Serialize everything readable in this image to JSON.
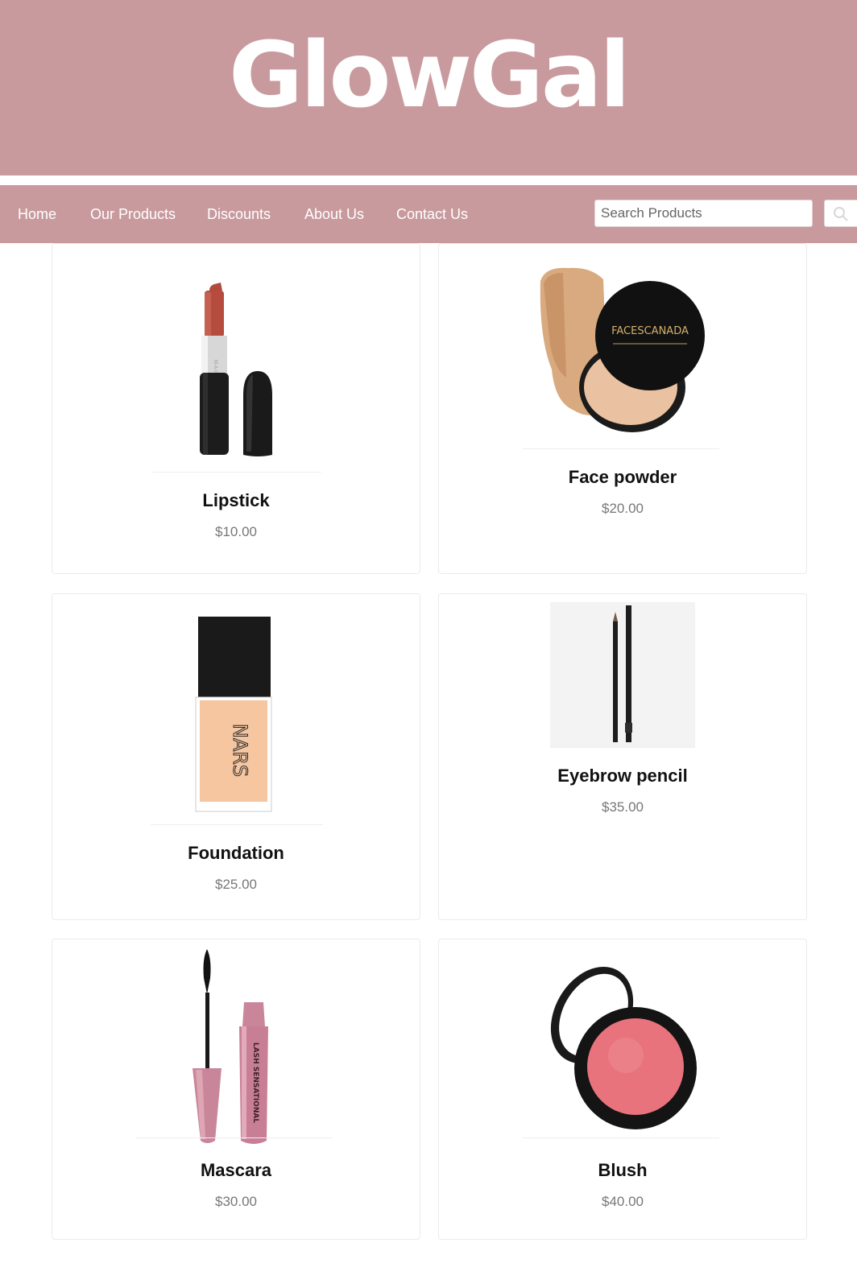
{
  "brand": {
    "title": "GlowGal"
  },
  "nav": {
    "items": [
      "Home",
      "Our Products",
      "Discounts",
      "About Us",
      "Contact Us"
    ],
    "search_placeholder": "Search Products"
  },
  "products": [
    {
      "name": "Lipstick",
      "price": "$10.00"
    },
    {
      "name": "Face powder",
      "price": "$20.00",
      "packaging_text": "FACESCANADA"
    },
    {
      "name": "Foundation",
      "price": "$25.00",
      "packaging_text": "NARS"
    },
    {
      "name": "Eyebrow pencil",
      "price": "$35.00"
    },
    {
      "name": "Mascara",
      "price": "$30.00",
      "packaging_text": "LASH SENSATIONAL"
    },
    {
      "name": "Blush",
      "price": "$40.00"
    }
  ],
  "colors": {
    "brand_pink": "#c89a9e",
    "card_border": "#ebebeb",
    "price_gray": "#777777"
  }
}
